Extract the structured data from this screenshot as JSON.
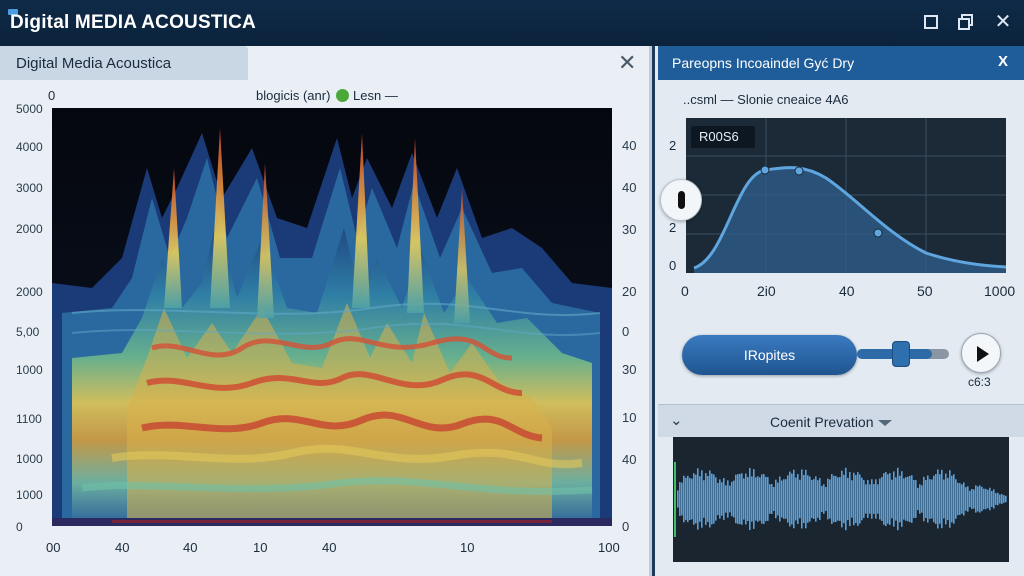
{
  "window": {
    "title": "Digital MEDIA ACOUSTICA"
  },
  "left_panel": {
    "tab_label": "Digital Media Acoustica",
    "legend_text": "blogicis (anr)",
    "legend_series": "Lesn —",
    "y_top_label": "0",
    "y_axis_left": [
      "5000",
      "4000",
      "3000",
      "2000",
      "2000",
      "5,00",
      "1000",
      "1100",
      "1000",
      "1000",
      "0"
    ],
    "y_axis_right": [
      "40",
      "40",
      "30",
      "20",
      "0",
      "30",
      "10",
      "40",
      "0"
    ],
    "x_axis": [
      "00",
      "40",
      "40",
      "10",
      "40",
      "10",
      "100"
    ]
  },
  "right_panel": {
    "header_title": "Pareopns Incoaindel Gyć Dry",
    "header_close": "X",
    "curve_caption": "..csml — Slonie cneaice 4A6",
    "tooltip": "R00S6",
    "curve_y_labels": [
      "2",
      "2",
      "0"
    ],
    "curve_x_labels": [
      "0",
      "2i0",
      "40",
      "50",
      "1000"
    ],
    "properties_button": "IRopites",
    "slider_value": 0.82,
    "play_caption": "c6:3",
    "section_title": "Coenit Prevation",
    "accent_color": "#1f5d9a"
  }
}
